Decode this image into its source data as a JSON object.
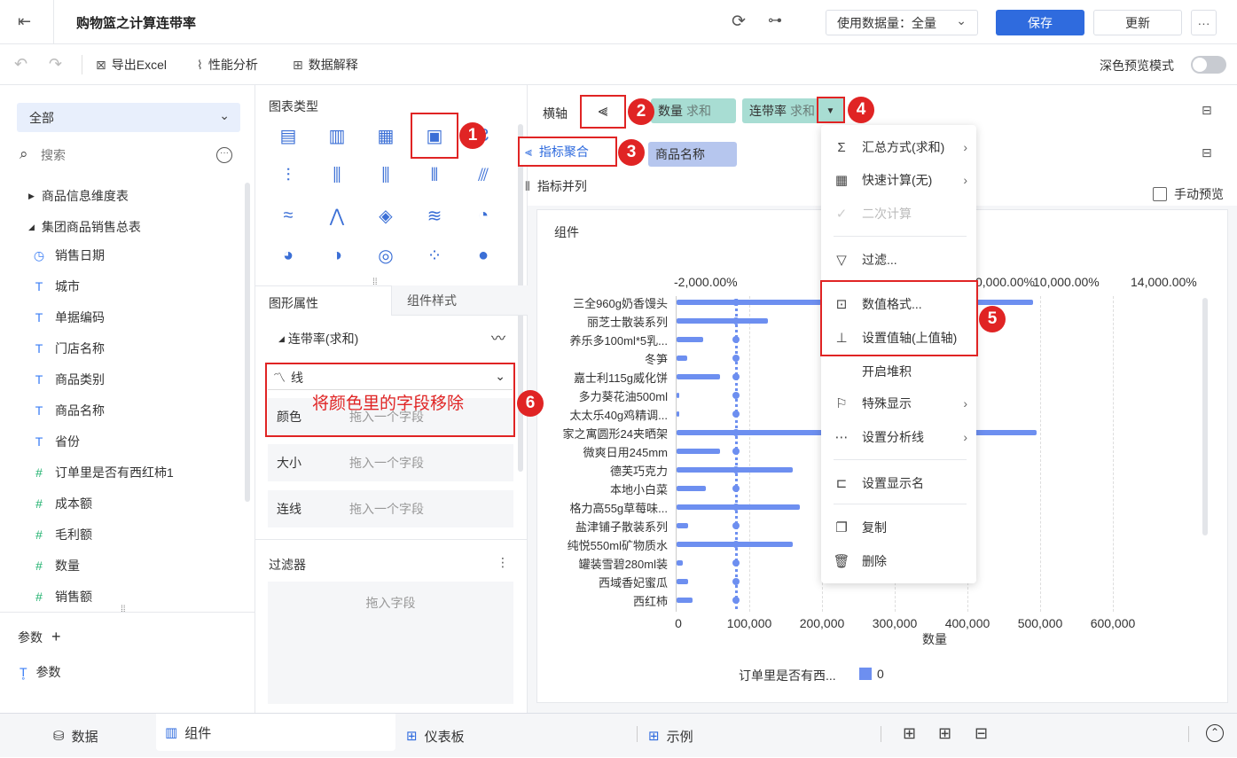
{
  "header": {
    "title": "购物篮之计算连带率",
    "data_usage": "使用数据量：全量",
    "save": "保存",
    "update": "更新",
    "more": "···"
  },
  "toolbar": {
    "export": "导出Excel",
    "perf": "性能分析",
    "explain": "数据解释",
    "dark_mode": "深色预览模式"
  },
  "left": {
    "select": "全部",
    "search_placeholder": "搜索",
    "tables": [
      "商品信息维度表",
      "集团商品销售总表"
    ],
    "fields": [
      {
        "icon": "clock-icon",
        "glyph": "◷",
        "label": "销售日期"
      },
      {
        "icon": "text-icon",
        "glyph": "T",
        "label": "城市"
      },
      {
        "icon": "text-icon",
        "glyph": "T",
        "label": "单据编码"
      },
      {
        "icon": "text-icon",
        "glyph": "T",
        "label": "门店名称"
      },
      {
        "icon": "text-icon",
        "glyph": "T",
        "label": "商品类别"
      },
      {
        "icon": "text-icon",
        "glyph": "T",
        "label": "商品名称"
      },
      {
        "icon": "text-icon",
        "glyph": "T",
        "label": "省份"
      },
      {
        "icon": "calc-field-icon",
        "glyph": "#",
        "label": "订单里是否有西红柿1"
      },
      {
        "icon": "number-icon",
        "glyph": "#",
        "label": "成本额"
      },
      {
        "icon": "number-icon",
        "glyph": "#",
        "label": "毛利额"
      },
      {
        "icon": "number-icon",
        "glyph": "#",
        "label": "数量"
      },
      {
        "icon": "number-icon",
        "glyph": "#",
        "label": "销售额"
      }
    ],
    "params_title": "参数",
    "params_item": "参数"
  },
  "mid": {
    "chart_types_title": "图表类型",
    "tab_props": "图形属性",
    "tab_style": "组件样式",
    "series": "连带率(求和)",
    "mark_type": "线",
    "props": [
      {
        "label": "颜色",
        "placeholder": "拖入一个字段"
      },
      {
        "label": "大小",
        "placeholder": "拖入一个字段"
      },
      {
        "label": "连线",
        "placeholder": "拖入一个字段"
      }
    ],
    "filter_title": "过滤器",
    "filter_placeholder": "拖入字段",
    "annotation": "将颜色里的字段移除"
  },
  "axis": {
    "h_label": "横轴",
    "pill1_name": "数量",
    "pill1_agg": "求和",
    "pill2_name": "连带率",
    "pill2_agg": "求和",
    "agg_mode": "指标聚合",
    "parallel_mode": "指标并列",
    "v_pill": "商品名称",
    "manual_preview": "手动预览"
  },
  "menu": {
    "items": [
      {
        "icon": "sigma-icon",
        "glyph": "Σ",
        "label": "汇总方式(求和)",
        "arrow": true
      },
      {
        "icon": "calculator-icon",
        "glyph": "▦",
        "label": "快速计算(无)",
        "arrow": true
      },
      {
        "icon": "check-icon",
        "glyph": "✓",
        "label": "二次计算",
        "disabled": true
      },
      {
        "icon": "filter-icon",
        "glyph": "▽",
        "label": "过滤..."
      },
      {
        "icon": "number-format-icon",
        "glyph": "⊡",
        "label": "数值格式..."
      },
      {
        "icon": "value-axis-icon",
        "glyph": "⊥",
        "label": "设置值轴(上值轴)"
      },
      {
        "icon": "",
        "glyph": "",
        "label": "开启堆积"
      },
      {
        "icon": "flag-icon",
        "glyph": "⚐",
        "label": "特殊显示",
        "arrow": true
      },
      {
        "icon": "analysis-line-icon",
        "glyph": "⋯",
        "label": "设置分析线",
        "arrow": true
      },
      {
        "icon": "rename-icon",
        "glyph": "⊏",
        "label": "设置显示名"
      },
      {
        "icon": "copy-icon",
        "glyph": "❐",
        "label": "复制"
      },
      {
        "icon": "trash-icon",
        "glyph": "🗑",
        "label": "删除"
      }
    ]
  },
  "chart_data": {
    "type": "bar",
    "title": "组件",
    "categories": [
      "三全960g奶香馒头",
      "丽芝士散装系列",
      "养乐多100ml*5乳...",
      "冬笋",
      "嘉士利115g威化饼",
      "多力葵花油500ml",
      "太太乐40g鸡精调...",
      "家之寓圆形24夹晒架",
      "微爽日用245mm",
      "德芙巧克力",
      "本地小白菜",
      "格力高55g草莓味...",
      "盐津铺子散装系列",
      "纯悦550ml矿物质水",
      "罐装雪碧280ml装",
      "西域香妃蜜瓜",
      "西红柿"
    ],
    "series": [
      {
        "values": [
          490000,
          125000,
          36000,
          15000,
          60000,
          4000,
          3000,
          495000,
          60000,
          160000,
          40000,
          170000,
          16000,
          160000,
          8000,
          16000,
          22000
        ]
      }
    ],
    "xlabel": "数量",
    "xticks": [
      "0",
      "100,000",
      "200,000",
      "300,000",
      "400,000",
      "500,000",
      "600,000"
    ],
    "xlim": [
      0,
      600000
    ],
    "top_ticks": [
      "-2,000.00%",
      "0,000.00%",
      "10,000.00%",
      "14,000.00%"
    ],
    "legend_title": "订单里是否有西...",
    "legend_value": "0",
    "legend_color": "#6d8ff0"
  },
  "bottom": {
    "data": "数据",
    "component": "组件",
    "dashboard": "仪表板",
    "example": "示例"
  },
  "badges": [
    "1",
    "2",
    "3",
    "4",
    "5",
    "6"
  ],
  "colors": {
    "primary": "#2f6bde",
    "bar": "#6d8ff0",
    "red": "#e02424",
    "pill_green": "#a8ddd3",
    "pill_blue": "#b6c6ee"
  }
}
